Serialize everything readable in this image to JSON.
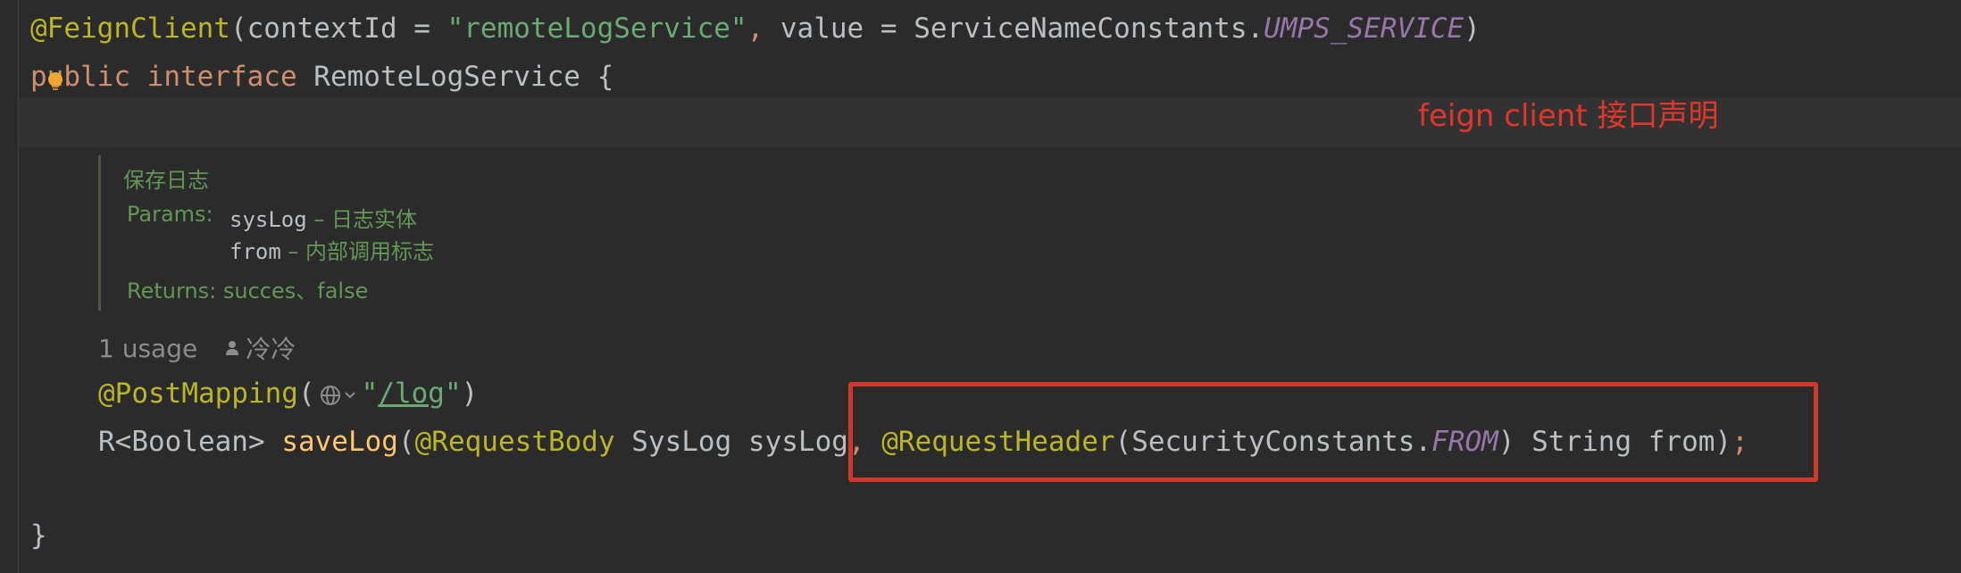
{
  "code": {
    "line1": {
      "annotation": "@FeignClient",
      "open": "(contextId = ",
      "context_id": "\"remoteLogService\"",
      "comma": ", value = ServiceNameConstants.",
      "const": "UMPS_SERVICE",
      "close": ")"
    },
    "line2": {
      "kw_public": "public",
      "space1": " ",
      "kw_interface": "interface",
      "rest": " RemoteLogService {"
    },
    "mapping_line": {
      "annotation": "@PostMapping",
      "open": "(",
      "quote_open": "\"",
      "path": "/log",
      "quote_close": "\"",
      "close": ")"
    },
    "method_line": {
      "ret": "R<Boolean> ",
      "fn": "saveLog",
      "p1": "(",
      "ann1": "@RequestBody",
      "p2": " SysLog sysLog",
      "comma": ", ",
      "ann2": "@RequestHeader",
      "p3": "(SecurityConstants.",
      "const": "FROM",
      "p4": ") String from)",
      "semi": ";"
    },
    "closing_brace": "}"
  },
  "doc": {
    "summary": "保存日志",
    "params_label": "Params:",
    "param1_name": "sysLog",
    "param1_desc": " – 日志实体",
    "param2_name": "from",
    "param2_desc": " – 内部调用标志",
    "returns_label": "Returns:",
    "returns_value": "succes、false"
  },
  "inlay": {
    "usage": "1 usage",
    "author": "冷冷"
  },
  "callout": "feign client 接口声明",
  "icons": {
    "bulb": "lightbulb-icon",
    "globe": "globe-icon",
    "person": "person-icon"
  },
  "colors": {
    "highlight_box": "#d2372b",
    "callout_text": "#e0362c"
  }
}
